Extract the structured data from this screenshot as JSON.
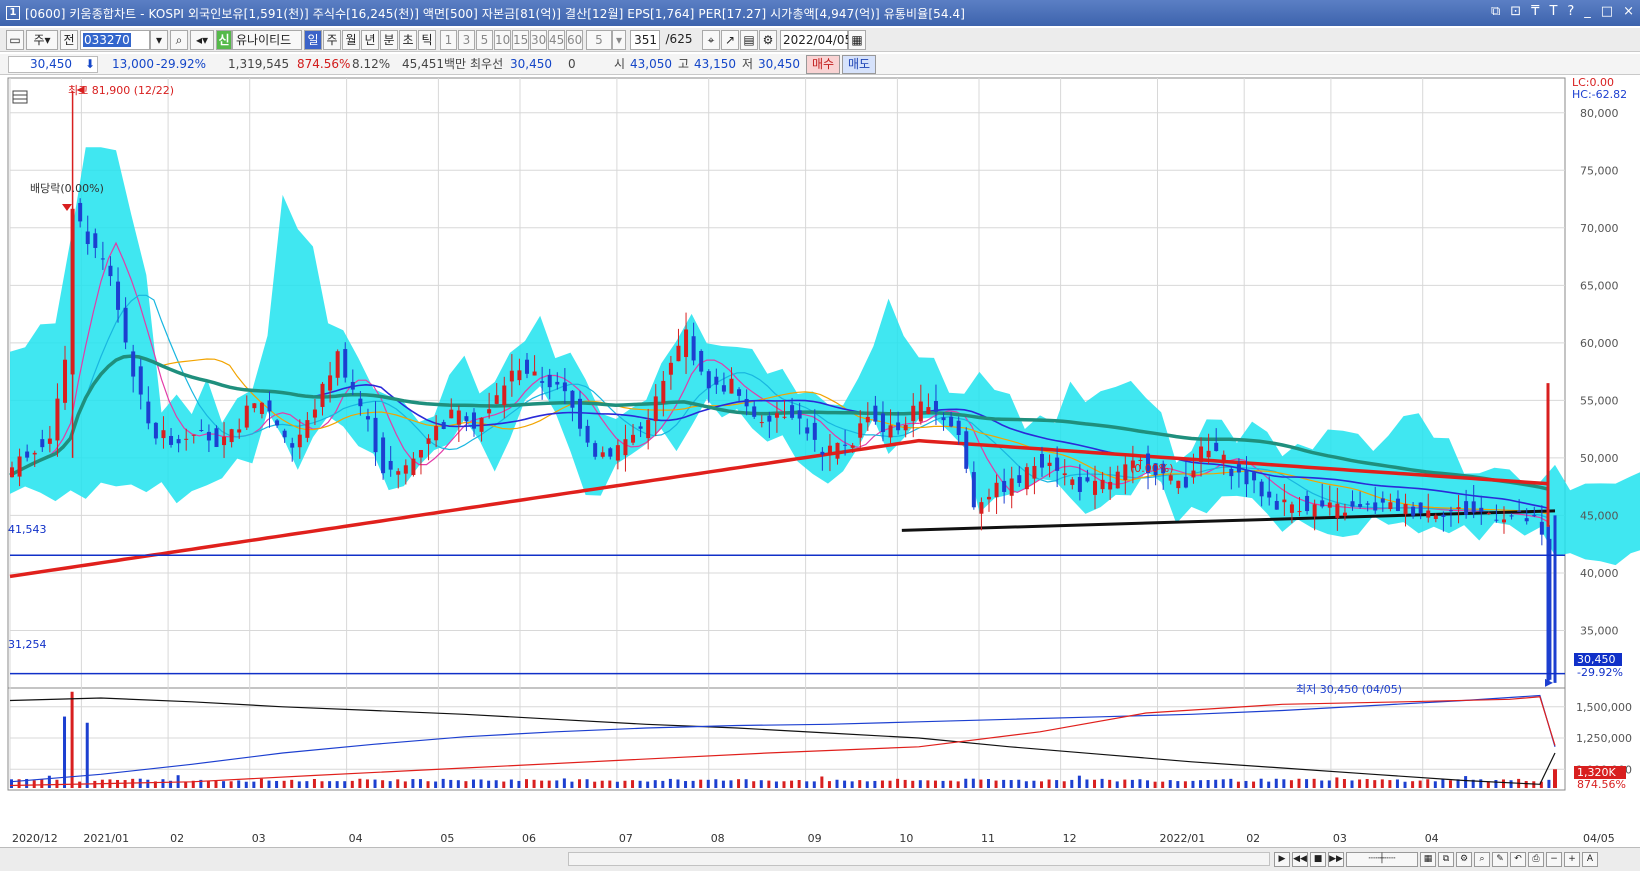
{
  "window": {
    "icon_label": "1",
    "title": "[0600] 키움종합차트 - KOSPI 외국인보유[1,591(천)] 주식수[16,245(천)] 액면[500] 자본금[81(억)] 결산[12월] EPS[1,764] PER[17.27] 시가총액[4,947(억)] 유통비율[54.4]",
    "controls": [
      "⧉",
      "⊡",
      "₸",
      "T",
      "?",
      "_",
      "□",
      "×"
    ]
  },
  "toolbar": {
    "market_selector": "주",
    "prev_label": "전",
    "stock_code": "033270",
    "stock_name": "유나이티드",
    "stock_market_badge": "신",
    "period_buttons": [
      "일",
      "주",
      "월",
      "년",
      "분",
      "초",
      "틱"
    ],
    "active_period": "일",
    "interval_buttons": [
      "1",
      "3",
      "5",
      "10",
      "15",
      "30",
      "45",
      "60"
    ],
    "interval_value": "5",
    "bars_shown": "351",
    "bars_total": "/625",
    "date": "2022/04/05"
  },
  "quote": {
    "price": "30,450",
    "change": "13,000",
    "change_pct": "-29.92%",
    "volume": "1,319,545",
    "volume_ratio": "874.56%",
    "turnover": "8.12%",
    "trade_value": "45,451백만",
    "priority_label": "최우선",
    "priority_price": "30,450",
    "priority_qty": "0",
    "open_label": "시",
    "open": "43,050",
    "high_label": "고",
    "high": "43,150",
    "low_label": "저",
    "low": "30,450",
    "buy_label": "매수",
    "sell_label": "매도"
  },
  "colors": {
    "up": "#d81f1f",
    "down": "#1c3fd0",
    "cloud": "#1fe3ee",
    "ma_long": "#e0201c",
    "ma_mid": "#1f8f7d",
    "trendline": "#111111",
    "hline": "#1030c8"
  },
  "chart_data": {
    "type": "candlestick",
    "x_ticks": [
      "2020/12",
      "2021/01",
      "02",
      "03",
      "04",
      "05",
      "06",
      "07",
      "08",
      "09",
      "10",
      "11",
      "12",
      "2022/01",
      "02",
      "03",
      "04",
      "04/05"
    ],
    "ylim": [
      30000,
      82500
    ],
    "y_ticks": [
      "80,000",
      "75,000",
      "70,000",
      "65,000",
      "60,000",
      "55,000",
      "50,000",
      "45,000",
      "40,000",
      "35,000"
    ],
    "lc_label": "LC:0.00",
    "hc_label": "HC:-62.82",
    "high_marker": "최고 81,900 (12/22)",
    "low_marker": "최저 30,450 (04/05)",
    "dividend_marker": "배당락(0.00%)",
    "hline_upper": {
      "label": "41,543",
      "value": 41543
    },
    "hline_lower": {
      "label": "31,254",
      "value": 31254
    },
    "last_price_tag": "30,450",
    "last_change_tag": "-29.92%",
    "trend_annotation": "(0.00%)",
    "price_path": [
      [
        0,
        48500
      ],
      [
        3,
        50500
      ],
      [
        6,
        52000
      ],
      [
        8,
        58000
      ],
      [
        9,
        72000
      ],
      [
        10,
        70000
      ],
      [
        12,
        68000
      ],
      [
        14,
        66000
      ],
      [
        16,
        60000
      ],
      [
        18,
        55000
      ],
      [
        20,
        52000
      ],
      [
        23,
        51500
      ],
      [
        26,
        53000
      ],
      [
        28,
        50500
      ],
      [
        30,
        52000
      ],
      [
        32,
        54000
      ],
      [
        34,
        55000
      ],
      [
        36,
        53000
      ],
      [
        38,
        51000
      ],
      [
        40,
        53000
      ],
      [
        42,
        56000
      ],
      [
        44,
        59000
      ],
      [
        46,
        56000
      ],
      [
        48,
        53000
      ],
      [
        50,
        49000
      ],
      [
        52,
        48500
      ],
      [
        54,
        50000
      ],
      [
        56,
        52000
      ],
      [
        58,
        53000
      ],
      [
        60,
        54500
      ],
      [
        62,
        53000
      ],
      [
        64,
        54000
      ],
      [
        66,
        56500
      ],
      [
        68,
        58000
      ],
      [
        70,
        57000
      ],
      [
        72,
        56500
      ],
      [
        74,
        55500
      ],
      [
        76,
        53000
      ],
      [
        78,
        50500
      ],
      [
        80,
        50500
      ],
      [
        82,
        51500
      ],
      [
        84,
        52500
      ],
      [
        86,
        55000
      ],
      [
        88,
        58000
      ],
      [
        90,
        61000
      ],
      [
        92,
        57000
      ],
      [
        94,
        56000
      ],
      [
        96,
        56500
      ],
      [
        98,
        54000
      ],
      [
        100,
        53500
      ],
      [
        102,
        54000
      ],
      [
        104,
        54000
      ],
      [
        106,
        52500
      ],
      [
        108,
        50000
      ],
      [
        110,
        51000
      ],
      [
        112,
        51500
      ],
      [
        114,
        54000
      ],
      [
        116,
        52500
      ],
      [
        118,
        52500
      ],
      [
        120,
        54000
      ],
      [
        122,
        55000
      ],
      [
        124,
        53500
      ],
      [
        126,
        52000
      ],
      [
        128,
        46000
      ],
      [
        130,
        47000
      ],
      [
        132,
        47500
      ],
      [
        134,
        48000
      ],
      [
        136,
        49500
      ],
      [
        138,
        50000
      ],
      [
        140,
        48500
      ],
      [
        142,
        47500
      ],
      [
        144,
        47500
      ],
      [
        146,
        48000
      ],
      [
        148,
        49000
      ],
      [
        150,
        49500
      ],
      [
        152,
        49000
      ],
      [
        154,
        48000
      ],
      [
        156,
        48000
      ],
      [
        158,
        50500
      ],
      [
        160,
        50500
      ],
      [
        162,
        49000
      ],
      [
        164,
        48000
      ],
      [
        166,
        47000
      ],
      [
        168,
        46000
      ],
      [
        170,
        46000
      ],
      [
        172,
        45800
      ],
      [
        174,
        45700
      ],
      [
        176,
        45600
      ],
      [
        178,
        45500
      ],
      [
        180,
        45600
      ],
      [
        182,
        45800
      ],
      [
        184,
        45700
      ],
      [
        186,
        45500
      ],
      [
        188,
        45400
      ],
      [
        190,
        45400
      ],
      [
        192,
        45400
      ],
      [
        194,
        45300
      ],
      [
        196,
        45200
      ],
      [
        198,
        45000
      ],
      [
        200,
        44800
      ],
      [
        202,
        44500
      ],
      [
        203,
        43000
      ],
      [
        204,
        30450
      ]
    ],
    "bars_total": 204,
    "sub_chart": {
      "type": "line",
      "y_ticks": [
        "1,500,000",
        "1,250,000",
        "1,000,000"
      ],
      "ylim": [
        850000,
        1650000
      ],
      "vol_tag": "1,320K",
      "vol_pct_tag": "874.56%",
      "series": [
        {
          "color": "#111111",
          "values": [
            [
              0,
              1550000
            ],
            [
              12,
              1570000
            ],
            [
              24,
              1540000
            ],
            [
              36,
              1500000
            ],
            [
              48,
              1470000
            ],
            [
              60,
              1440000
            ],
            [
              72,
              1400000
            ],
            [
              84,
              1360000
            ],
            [
              96,
              1330000
            ],
            [
              108,
              1290000
            ],
            [
              120,
              1250000
            ],
            [
              132,
              1180000
            ],
            [
              144,
              1120000
            ],
            [
              156,
              1060000
            ],
            [
              168,
              1010000
            ],
            [
              180,
              960000
            ],
            [
              192,
              910000
            ],
            [
              202,
              880000
            ],
            [
              204,
              1130000
            ]
          ]
        },
        {
          "color": "#1c3fd0",
          "values": [
            [
              0,
              900000
            ],
            [
              12,
              960000
            ],
            [
              24,
              1040000
            ],
            [
              36,
              1130000
            ],
            [
              48,
              1200000
            ],
            [
              60,
              1260000
            ],
            [
              72,
              1300000
            ],
            [
              84,
              1330000
            ],
            [
              96,
              1350000
            ],
            [
              108,
              1360000
            ],
            [
              120,
              1380000
            ],
            [
              132,
              1400000
            ],
            [
              144,
              1420000
            ],
            [
              156,
              1440000
            ],
            [
              168,
              1470000
            ],
            [
              180,
              1510000
            ],
            [
              192,
              1550000
            ],
            [
              202,
              1590000
            ],
            [
              204,
              1180000
            ]
          ]
        },
        {
          "color": "#e0201c",
          "values": [
            [
              0,
              870000
            ],
            [
              24,
              900000
            ],
            [
              40,
              950000
            ],
            [
              60,
              1010000
            ],
            [
              80,
              1070000
            ],
            [
              100,
              1130000
            ],
            [
              120,
              1180000
            ],
            [
              136,
              1300000
            ],
            [
              150,
              1450000
            ],
            [
              168,
              1520000
            ],
            [
              184,
              1540000
            ],
            [
              198,
              1560000
            ],
            [
              202,
              1580000
            ],
            [
              204,
              1190000
            ]
          ]
        }
      ]
    }
  }
}
